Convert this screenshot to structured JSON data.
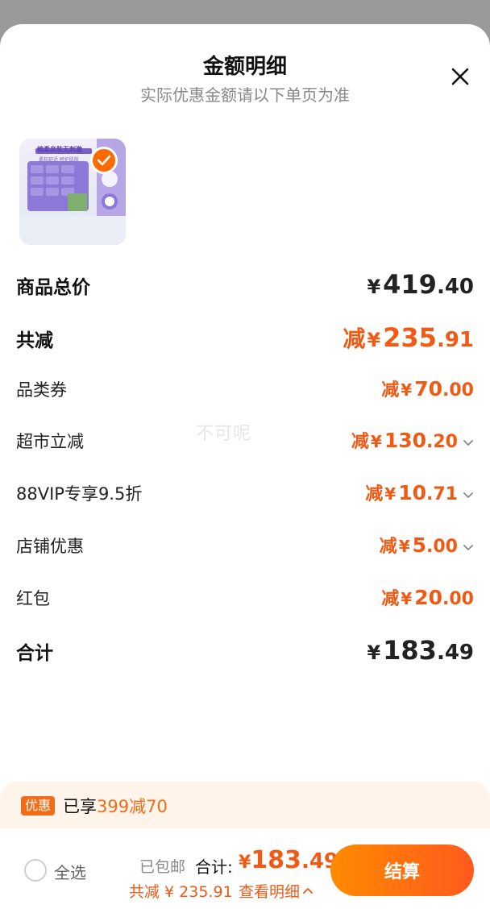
{
  "sheet": {
    "title": "金额明细",
    "subtitle": "实际优惠金额请以下单页为准"
  },
  "product": {
    "image_caption": "棉柔亲肤无刺激",
    "image_subcaption": "柔软舒适 呵护肌肤"
  },
  "rows": [
    {
      "label": "商品总价",
      "prefix": "",
      "yen": "¥",
      "int": "419",
      "dec": ".40",
      "color": "dark",
      "bold": true,
      "chevron": false
    },
    {
      "label": "共减",
      "prefix": "减",
      "yen": "¥",
      "int": "235",
      "dec": ".91",
      "color": "orange",
      "bold": true,
      "chevron": false
    },
    {
      "label": "品类券",
      "prefix": "减",
      "yen": "¥",
      "int": "70",
      "dec": ".00",
      "color": "orange",
      "bold": false,
      "chevron": false
    },
    {
      "label": "超市立减",
      "prefix": "减",
      "yen": "¥",
      "int": "130",
      "dec": ".20",
      "color": "orange",
      "bold": false,
      "chevron": true
    },
    {
      "label": "88VIP专享9.5折",
      "prefix": "减",
      "yen": "¥",
      "int": "10",
      "dec": ".71",
      "color": "orange",
      "bold": false,
      "chevron": true
    },
    {
      "label": "店铺优惠",
      "prefix": "减",
      "yen": "¥",
      "int": "5",
      "dec": ".00",
      "color": "orange",
      "bold": false,
      "chevron": true
    },
    {
      "label": "红包",
      "prefix": "减",
      "yen": "¥",
      "int": "20",
      "dec": ".00",
      "color": "orange",
      "bold": false,
      "chevron": false
    },
    {
      "label": "合计",
      "prefix": "",
      "yen": "¥",
      "int": "183",
      "dec": ".49",
      "color": "dark",
      "bold": true,
      "chevron": false
    }
  ],
  "watermark": "不可呢",
  "promo": {
    "badge": "优惠",
    "text_prefix": "已享",
    "text_highlight": "399减70"
  },
  "bottom": {
    "select_all": "全选",
    "shipping": "已包邮",
    "total_label": "合计:",
    "total_yen": "¥",
    "total_int": "183",
    "total_dec": ".49",
    "saved": "共减 ¥ 235.91",
    "detail_link": "查看明细",
    "checkout": "结算"
  },
  "colors": {
    "accent": "#f05a14",
    "checkout_start": "#ff8a00",
    "checkout_end": "#ff5a1e",
    "promo_bg": "#fff4ea"
  }
}
